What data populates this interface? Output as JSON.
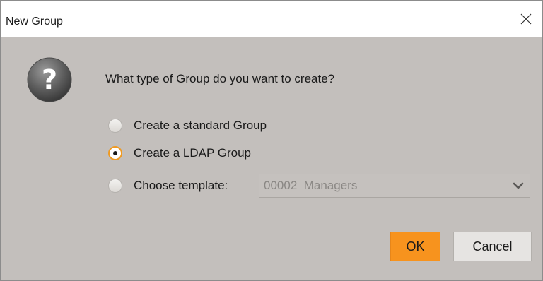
{
  "window": {
    "title": "New Group",
    "close_icon": "close-icon"
  },
  "dialog": {
    "icon": "question-icon",
    "prompt": "What type of Group do you want to create?",
    "options": [
      {
        "label": "Create a standard Group",
        "checked": false
      },
      {
        "label": "Create a LDAP Group",
        "checked": true
      },
      {
        "label": "Choose template:",
        "checked": false
      }
    ],
    "template_select": {
      "value": "00002  Managers",
      "disabled": true
    }
  },
  "buttons": {
    "ok_label": "OK",
    "cancel_label": "Cancel"
  },
  "colors": {
    "accent": "#f7931e",
    "background": "#c3bfbc",
    "titlebar": "#ffffff"
  }
}
